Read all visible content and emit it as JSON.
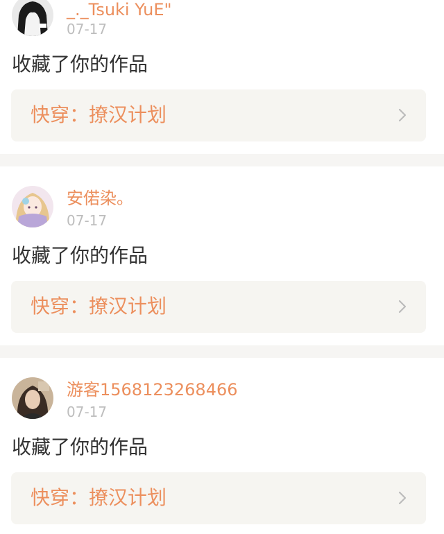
{
  "notifications": [
    {
      "username": "_._Tsuki YuE\"",
      "date": "07-17",
      "action": "收藏了你的作品",
      "work_title": "快穿：撩汉计划",
      "avatar_icon": "avatar-black-white-icon"
    },
    {
      "username": "安偌染。",
      "date": "07-17",
      "action": "收藏了你的作品",
      "work_title": "快穿：撩汉计划",
      "avatar_icon": "avatar-anime-girl-icon"
    },
    {
      "username": "游客1568123268466",
      "date": "07-17",
      "action": "收藏了你的作品",
      "work_title": "快穿：撩汉计划",
      "avatar_icon": "avatar-photo-girl-icon"
    }
  ],
  "colors": {
    "accent": "#ec8f5d",
    "timestamp": "#bdbdbd",
    "text": "#333333",
    "link_background": "#f6f5f1",
    "divider": "#f6f5f3"
  }
}
